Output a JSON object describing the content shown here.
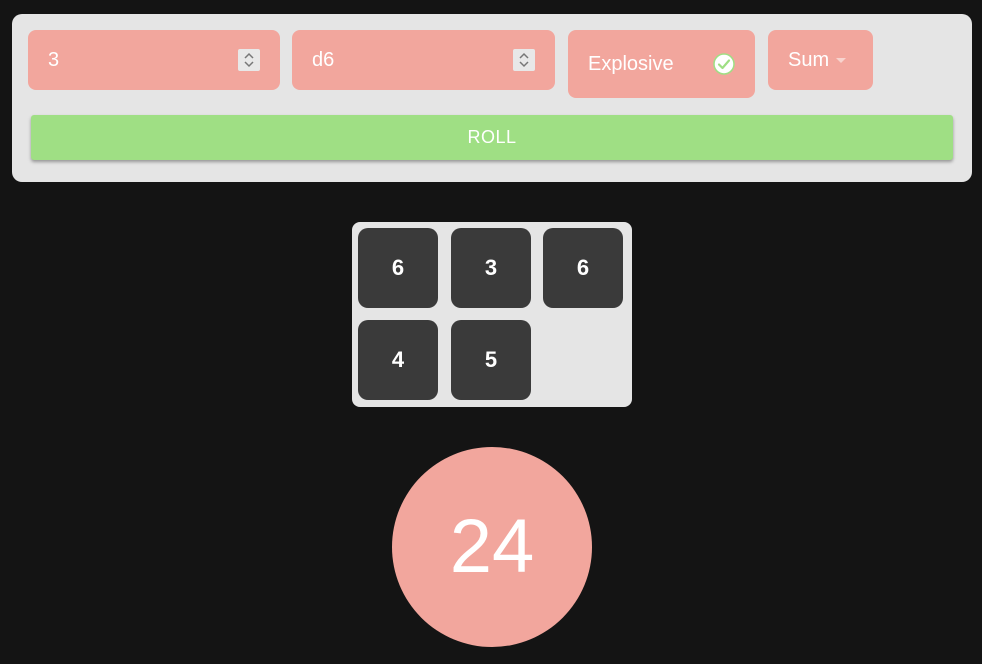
{
  "controls": {
    "dice_count": "3",
    "die_type": "d6",
    "explosive_label": "Explosive",
    "explosive_checked": true,
    "mode_label": "Sum",
    "roll_label": "ROLL"
  },
  "results": {
    "dice": [
      "6",
      "3",
      "6",
      "4",
      "5"
    ],
    "total": "24"
  },
  "colors": {
    "panel": "#e5e5e5",
    "field": "#f2a69d",
    "roll_button": "#9fdf84",
    "die_face": "#3a3a3a",
    "background": "#141414"
  },
  "icons": {
    "spinner": "spinner-arrows-icon",
    "check": "check-circle-icon",
    "caret": "caret-down-icon"
  }
}
